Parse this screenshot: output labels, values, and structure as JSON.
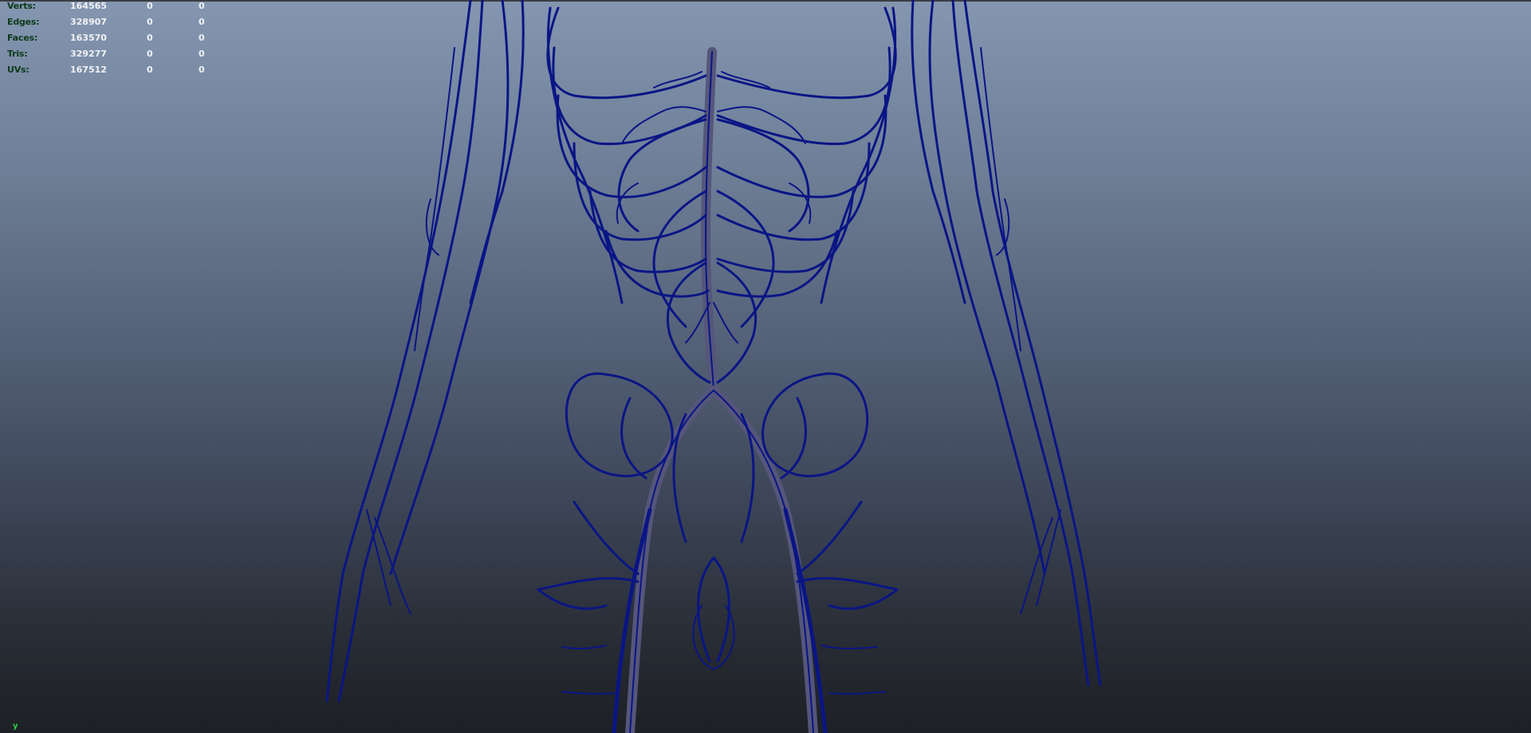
{
  "hud": {
    "rows": [
      {
        "label": "Verts:",
        "value": "164565",
        "selected": "0",
        "triangles": "0"
      },
      {
        "label": "Edges:",
        "value": "328907",
        "selected": "0",
        "triangles": "0"
      },
      {
        "label": "Faces:",
        "value": "163570",
        "selected": "0",
        "triangles": "0"
      },
      {
        "label": "Tris:",
        "value": "329277",
        "selected": "0",
        "triangles": "0"
      },
      {
        "label": "UVs:",
        "value": "167512",
        "selected": "0",
        "triangles": "0"
      }
    ]
  },
  "axis": {
    "label": "y"
  },
  "colors": {
    "vein": "#0a1585",
    "vessel_tube": "#55567a",
    "hud_label": "#0a3a1a",
    "hud_value": "#f1f3f6",
    "axis": "#2bd24a"
  }
}
